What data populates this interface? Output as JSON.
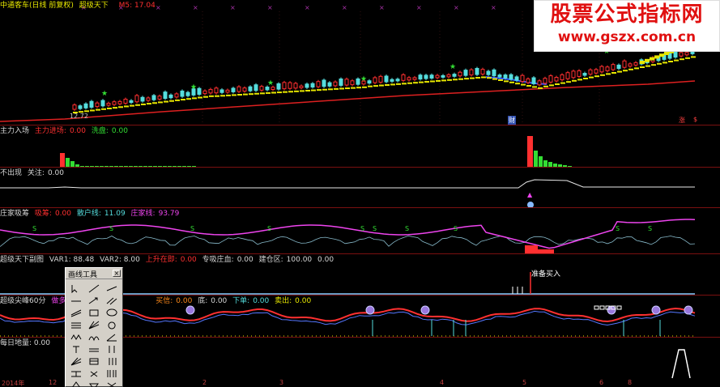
{
  "watermark": {
    "title": "股票公式指标网",
    "url": "www.gszx.com.cn"
  },
  "main_panel": {
    "title_parts": [
      "中通客车(日线 前复权)",
      "超级天下"
    ],
    "ma_label": "M5: 17.04",
    "low_marker": "12.72",
    "marker_cai": "财",
    "marker_zhang": "涨",
    "marker_dollar": "$"
  },
  "panel_zhuli": {
    "name": "主力入场",
    "label2": "主力进场:",
    "val2": "0.00",
    "label3": "洗盘:",
    "val3": "0.00"
  },
  "panel_chuxian": {
    "name": "不出现",
    "label2": "关注:",
    "val2": "0.00"
  },
  "panel_zhuangjia": {
    "name": "庄家吸筹",
    "label2": "吸筹:",
    "val2": "0.00",
    "label3": "散户线:",
    "val3": "11.09",
    "label4": "庄家线:",
    "val4": "93.79",
    "s_marker": "S"
  },
  "panel_chaojiting": {
    "name": "超级天下副图",
    "var1": "VAR1: 88.48",
    "var2": "VAR2: 8.00",
    "label3": "上升在即:",
    "val3": "0.00",
    "label4": "专吸庄血:",
    "val4": "0.00",
    "label5": "建仓区:",
    "val5": "100.00",
    "val6": "0.00",
    "annotation": "准备买入"
  },
  "panel_jianduan": {
    "name": "超级尖峰60分",
    "label2": "做多趋势",
    "label3": "买信:",
    "val3": "0.00",
    "label4": "底:",
    "val4": "0.00",
    "label5": "下单:",
    "val5": "0.00",
    "label6": "卖出:",
    "val6": "0.00"
  },
  "panel_diliang": {
    "name": "每日地量",
    "val": ": 0.00"
  },
  "toolbox": {
    "title": "画线工具",
    "close": "×"
  },
  "xaxis": {
    "labels": [
      "2014年",
      "12",
      "2",
      "3",
      "4",
      "5",
      "6",
      "8"
    ]
  },
  "colors": {
    "up": "#ff3030",
    "down": "#33dd33",
    "yellow": "#e8e800",
    "magenta": "#ee44ee",
    "cyan": "#55dddd",
    "red_line": "#dd2020",
    "blue": "#3355ff"
  }
}
